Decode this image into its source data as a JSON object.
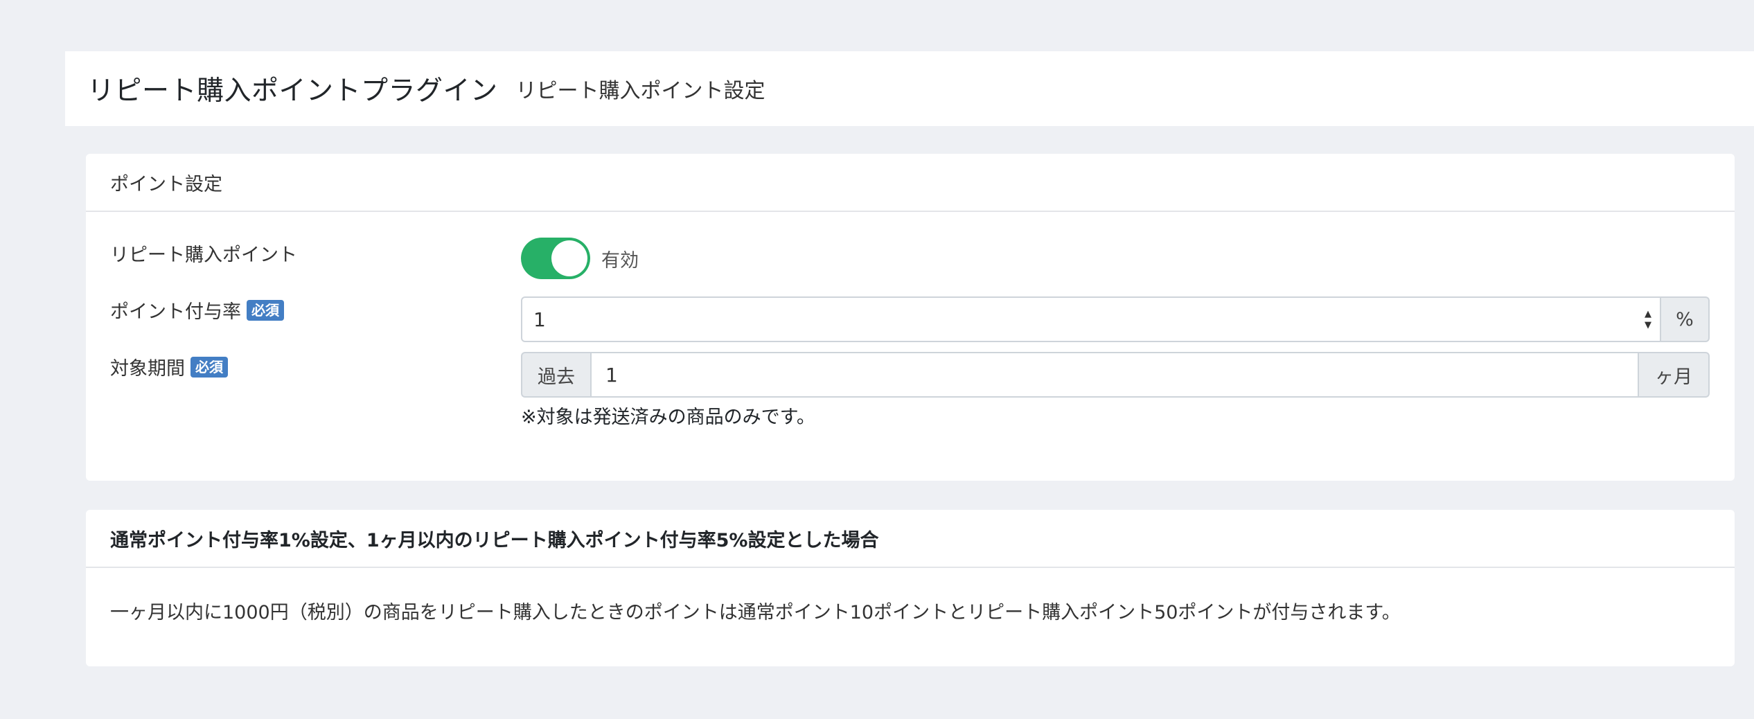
{
  "header": {
    "title": "リピート購入ポイントプラグイン",
    "subtitle": "リピート購入ポイント設定"
  },
  "settings_card": {
    "title": "ポイント設定",
    "repeat_point": {
      "label": "リピート購入ポイント",
      "toggle_state": "on",
      "toggle_text": "有効"
    },
    "rate": {
      "label": "ポイント付与率",
      "required_badge": "必須",
      "value": "1",
      "unit": "%"
    },
    "period": {
      "label": "対象期間",
      "required_badge": "必須",
      "prefix": "過去",
      "value": "1",
      "unit": "ヶ月",
      "note": "※対象は発送済みの商品のみです。"
    }
  },
  "example_card": {
    "title": "通常ポイント付与率1%設定、1ヶ月以内のリピート購入ポイント付与率5%設定とした場合",
    "body": "一ヶ月以内に1000円（税別）の商品をリピート購入したときのポイントは通常ポイント10ポイントとリピート購入ポイント50ポイントが付与されます。"
  },
  "colors": {
    "toggle_on": "#27b067",
    "badge": "#437ec4",
    "background": "#eef0f4"
  }
}
